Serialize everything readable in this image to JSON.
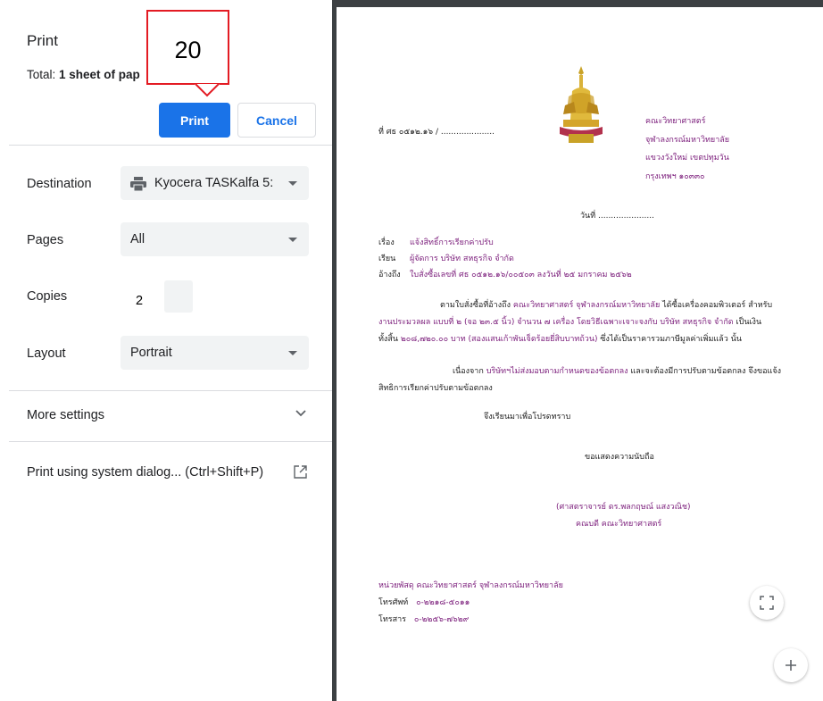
{
  "panel": {
    "title": "Print",
    "total_prefix": "Total: ",
    "total_bold": "1 sheet of pap",
    "print_label": "Print",
    "cancel_label": "Cancel",
    "destination_label": "Destination",
    "destination_value": "Kyocera TASKalfa 5:",
    "pages_label": "Pages",
    "pages_value": "All",
    "copies_label": "Copies",
    "copies_value": "2",
    "layout_label": "Layout",
    "layout_value": "Portrait",
    "more_settings_label": "More settings",
    "system_dialog_label": "Print using system dialog... (Ctrl+Shift+P)"
  },
  "annotation": {
    "number": "20",
    "color": "#e31b23"
  },
  "colors": {
    "accent": "#1a73e8",
    "doc_purple": "#7b1d7b"
  },
  "document": {
    "ref_no": "ที่ ศธ ๐๕๑๒.๑๖ / .....................",
    "org_lines": [
      "คณะวิทยาศาสตร์",
      "จุฬาลงกรณ์มหาวิทยาลัย",
      "แขวงวังใหม่ เขตปทุมวัน",
      "กรุงเทพฯ ๑๐๓๓๐"
    ],
    "date_line": "วันที่ ......................",
    "subject_label": "เรื่อง",
    "subject": "แจ้งสิทธิ์การเรียกค่าปรับ",
    "to_label": "เรียน",
    "to": "ผู้จัดการ บริษัท สหธุรกิจ จำกัด",
    "ref_label": "อ้างถึง",
    "ref": "ใบสั่งซื้อเลขที่ ศธ ๐๕๑๒.๑๖/๐๐๕๐๓ ลงวันที่ ๒๕ มกราคม ๒๕๖๒",
    "para1_line1_black": "ตามใบสั่งซื้อที่อ้างถึง",
    "para1_line1_purple": "คณะวิทยาศาสตร์ จุฬาลงกรณ์มหาวิทยาลัย",
    "para1_line1_black2": "ได้ซื้อเครื่องคอมพิวเตอร์ สำหรับ",
    "para1_line2_purple": "งานประมวลผล แบบที่ ๒ (จอ ๒๓.๕ นิ้ว) จำนวน ๗ เครื่อง โดยวิธีเฉพาะเจาะจงกับ บริษัท สหธุรกิจ จำกัด",
    "para1_line2_black": "เป็นเงิน",
    "para1_line3_black": "ทั้งสิ้น",
    "para1_line3_purple": "๒๐๘,๗๒๐.๐๐ บาท (สองแสนเก้าพันเจ็ดร้อยยี่สิบบาทถ้วน)",
    "para1_line3_black2": "ซึ่งได้เป็นราคารวมภาษีมูลค่าเพิ่มแล้ว นั้น",
    "para2_line1_black": "เนื่องจาก",
    "para2_line1_purple": "บริษัทฯไม่ส่งมอบตามกำหนดของข้อตกลง",
    "para2_line1_black2": "และจะต้องมีการปรับตามข้อตกลง จึงขอแจ้ง",
    "para2_line2": "สิทธิการเรียกค่าปรับตามข้อตกลง",
    "closing1": "จึงเรียนมาเพื่อโปรดทราบ",
    "closing2": "ขอแสดงความนับถือ",
    "signer_name": "(ศาสตราจารย์ ดร.พลกฤษณ์ แสงวณิช)",
    "signer_title": "คณบดี คณะวิทยาศาสตร์",
    "footer_unit": "หน่วยพัสดุ คณะวิทยาศาสตร์ จุฬาลงกรณ์มหาวิทยาลัย",
    "phone_label": "โทรศัพท์",
    "phone": "๐-๒๒๑๘-๕๐๑๑",
    "fax_label": "โทรสาร",
    "fax": "๐-๒๒๕๖-๗๖๒๙"
  }
}
